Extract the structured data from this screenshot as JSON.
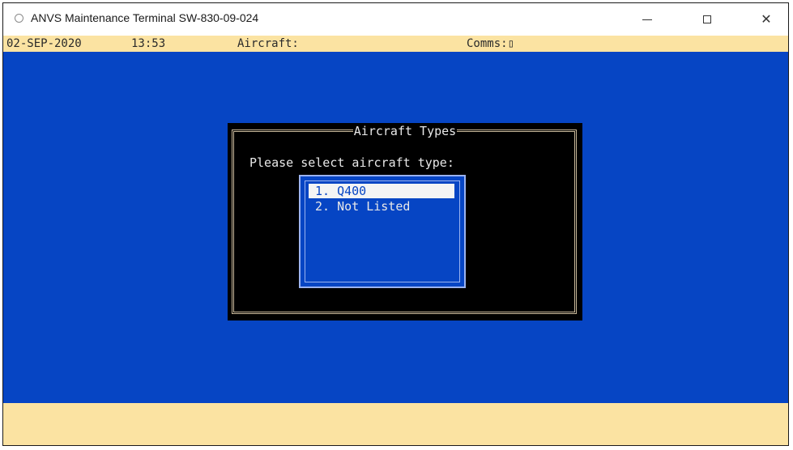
{
  "window": {
    "title": "ANVS Maintenance Terminal SW-830-09-024",
    "controls": {
      "minimize": "minimize-icon",
      "maximize": "maximize-icon",
      "close": "close-icon",
      "close_glyph": "✕"
    }
  },
  "status_bar": {
    "date": "02-SEP-2020",
    "time": "13:53",
    "aircraft_label": "Aircraft:",
    "comms_label": "Comms:",
    "comms_indicator": "▯"
  },
  "dialog": {
    "title": "Aircraft Types",
    "prompt": "Please select aircraft type:",
    "options": [
      {
        "label": "1. Q400",
        "selected": true
      },
      {
        "label": "2. Not Listed",
        "selected": false
      }
    ]
  },
  "colors": {
    "terminal_background": "#0645c4",
    "status_bar_background": "#fbe3a2",
    "dialog_background": "#000000",
    "dialog_border": "#c8b89a",
    "selection_background": "#f4f4f4"
  }
}
